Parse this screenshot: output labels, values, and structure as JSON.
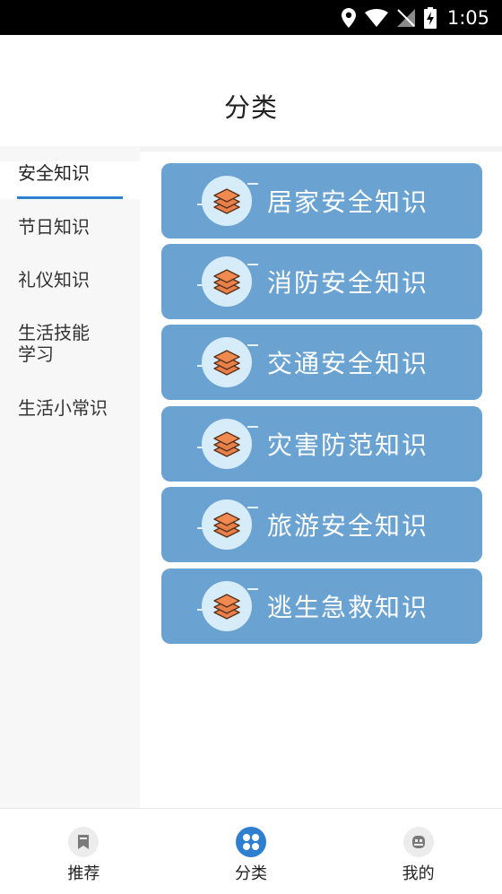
{
  "status_bar": {
    "time": "1:05",
    "icons": [
      "location-icon",
      "wifi-icon",
      "no-signal-icon",
      "battery-charging-icon"
    ]
  },
  "header": {
    "title": "分类"
  },
  "sidebar": {
    "items": [
      {
        "label": "安全知识",
        "active": true
      },
      {
        "label": "节日知识",
        "active": false
      },
      {
        "label": "礼仪知识",
        "active": false
      },
      {
        "label": "生活技能学习",
        "active": false
      },
      {
        "label": "生活小常识",
        "active": false
      }
    ]
  },
  "categories": [
    {
      "label": "居家安全知识",
      "icon": "layers-icon"
    },
    {
      "label": "消防安全知识",
      "icon": "layers-icon"
    },
    {
      "label": "交通安全知识",
      "icon": "layers-icon"
    },
    {
      "label": "灾害防范知识",
      "icon": "layers-icon"
    },
    {
      "label": "旅游安全知识",
      "icon": "layers-icon"
    },
    {
      "label": "逃生急救知识",
      "icon": "layers-icon"
    }
  ],
  "tabbar": {
    "tabs": [
      {
        "label": "推荐",
        "icon": "bookmark-icon",
        "active": false
      },
      {
        "label": "分类",
        "icon": "grid-icon",
        "active": true
      },
      {
        "label": "我的",
        "icon": "profile-icon",
        "active": false
      }
    ]
  },
  "colors": {
    "accent": "#2f7fd1",
    "card": "#6aa2d2",
    "icon_fill": "#e8804a",
    "badge": "#d7ecf9"
  }
}
